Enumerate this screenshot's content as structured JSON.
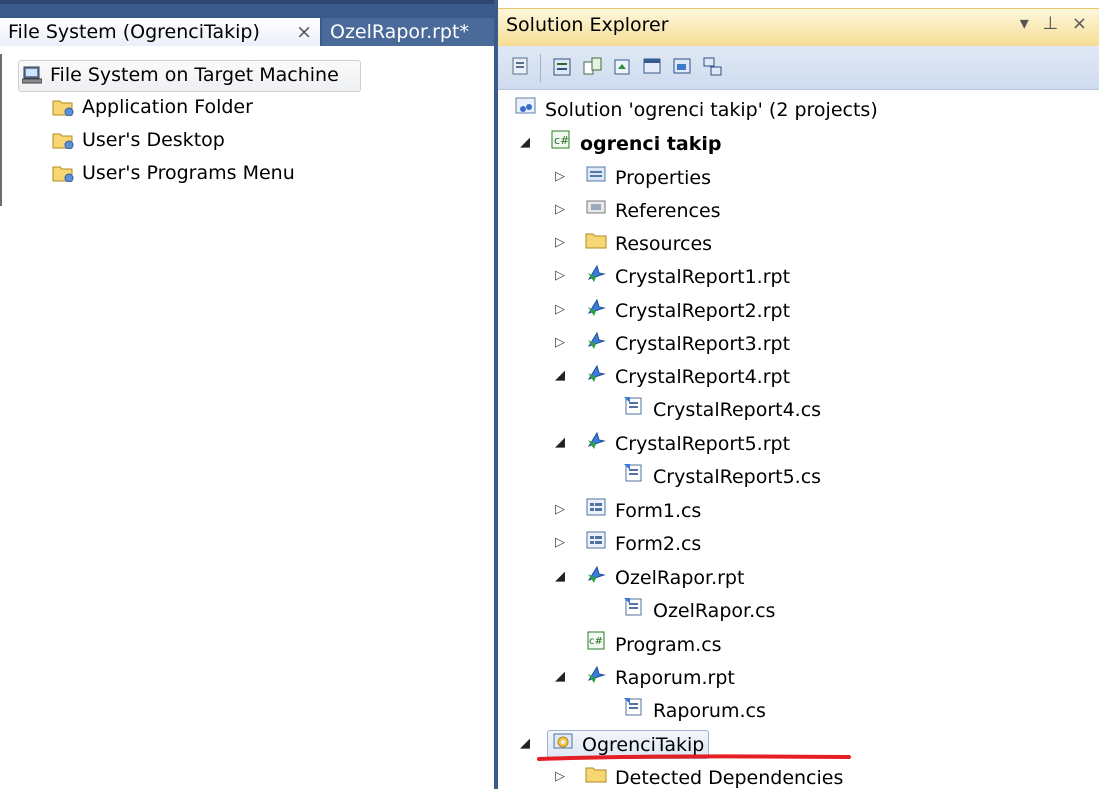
{
  "left_panel": {
    "tabs": [
      {
        "label": "File System (OgrenciTakip)",
        "close_glyph": "×"
      },
      {
        "label": "OzelRapor.rpt*"
      }
    ],
    "root": {
      "label": "File System on Target Machine",
      "icon": "computer-icon"
    },
    "items": [
      {
        "label": "Application Folder",
        "icon": "special-folder-icon"
      },
      {
        "label": "User's Desktop",
        "icon": "special-folder-icon"
      },
      {
        "label": "User's Programs Menu",
        "icon": "special-folder-icon"
      }
    ]
  },
  "solution_explorer": {
    "title": "Solution Explorer",
    "title_controls": "▾ ⊥ ×",
    "toolbar_icons": [
      "solution-icon",
      "properties-icon",
      "show-all-files-icon",
      "refresh-icon",
      "view-code-icon",
      "view-designer-icon",
      "class-diagram-icon"
    ],
    "tree": {
      "solution": "Solution 'ogrenci takip' (2 projects)",
      "project1": "ogrenci takip",
      "properties": "Properties",
      "references": "References",
      "resources": "Resources",
      "cr1": "CrystalReport1.rpt",
      "cr2": "CrystalReport2.rpt",
      "cr3": "CrystalReport3.rpt",
      "cr4": "CrystalReport4.rpt",
      "cr4cs": "CrystalReport4.cs",
      "cr5": "CrystalReport5.rpt",
      "cr5cs": "CrystalReport5.cs",
      "form1": "Form1.cs",
      "form2": "Form2.cs",
      "ozel": "OzelRapor.rpt",
      "ozelcs": "OzelRapor.cs",
      "program": "Program.cs",
      "raporum": "Raporum.rpt",
      "raporumcs": "Raporum.cs",
      "setup": "OgrenciTakip",
      "deps": "Detected Dependencies"
    }
  },
  "colors": {
    "accent_title": "#f5dd94",
    "tab_bar": "#3a5a8a",
    "red_mark": "#e31e24"
  }
}
